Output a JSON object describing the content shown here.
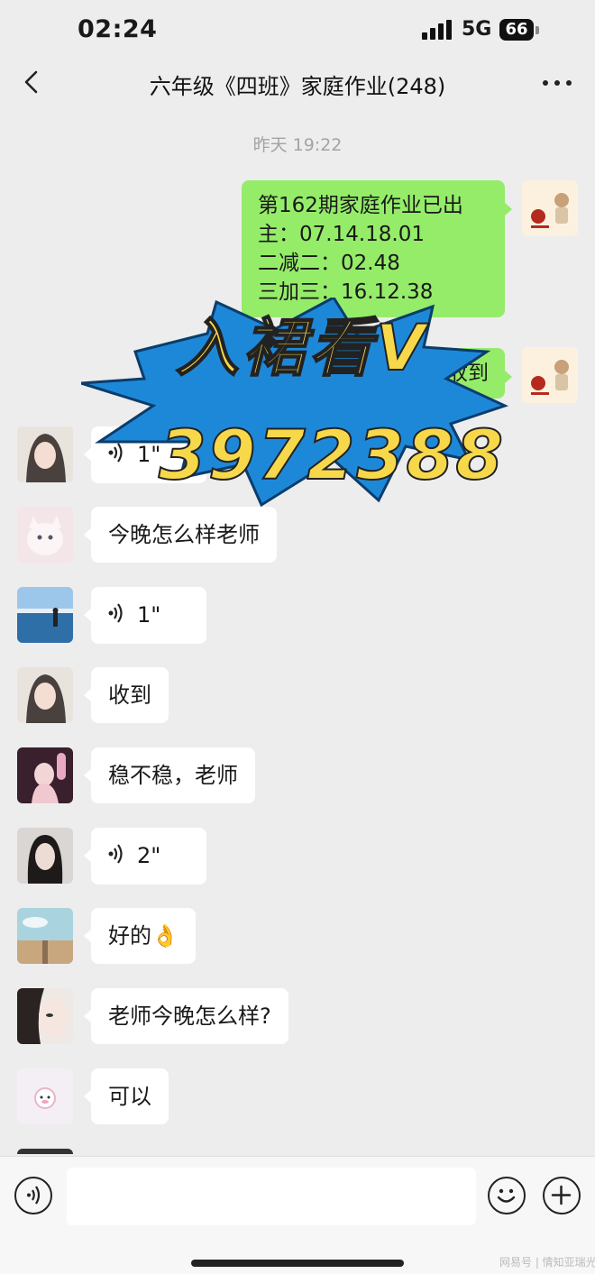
{
  "status_bar": {
    "time": "02:24",
    "network": "5G",
    "battery": "66"
  },
  "header": {
    "title": "六年级《四班》家庭作业(248)"
  },
  "timestamp": "昨天 19:22",
  "sent_messages": [
    {
      "lines": [
        "第162期家庭作业已出",
        "主：07.14.18.01",
        "二减二：02.48",
        "三加三：16.12.38"
      ]
    },
    {
      "lines": [
        "收到"
      ]
    }
  ],
  "received_messages": [
    {
      "type": "voice",
      "duration": "1\""
    },
    {
      "type": "text",
      "text": "今晚怎么样老师"
    },
    {
      "type": "voice",
      "duration": "1\""
    },
    {
      "type": "text",
      "text": "收到"
    },
    {
      "type": "text",
      "text": "稳不稳，老师"
    },
    {
      "type": "voice",
      "duration": "2\""
    },
    {
      "type": "text",
      "text": "好的👌"
    },
    {
      "type": "text",
      "text": "老师今晚怎么样?"
    },
    {
      "type": "text",
      "text": "可以"
    }
  ],
  "overlay": {
    "line1": "入裙看V",
    "line2": "3972388"
  },
  "input": {
    "placeholder": ""
  },
  "watermark": "网易号 | 情知亚瑞光",
  "colors": {
    "sent_bubble": "#95ec69",
    "background": "#ededed",
    "overlay_text": "#f6d84a",
    "overlay_burst": "#1e88d8"
  },
  "icons": [
    "back-arrow-icon",
    "more-dots-icon",
    "voice-wave-icon",
    "emoji-icon",
    "plus-icon"
  ]
}
